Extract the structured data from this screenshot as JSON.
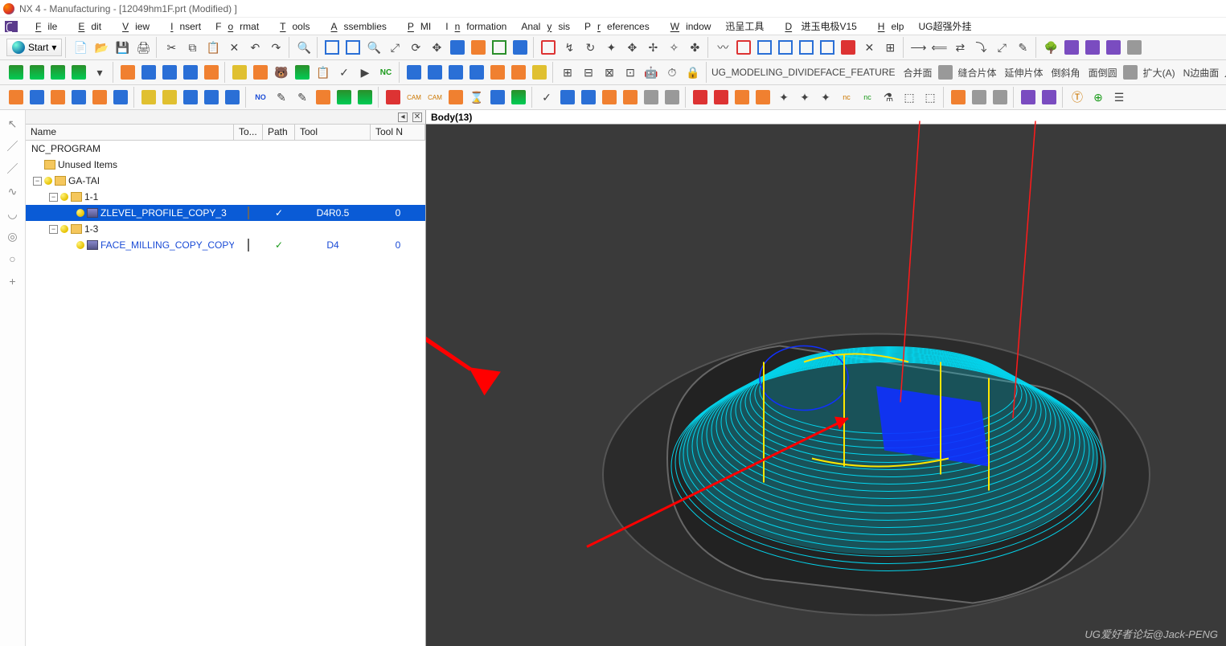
{
  "title": "NX 4 - Manufacturing - [12049hm1F.prt (Modified) ]",
  "menubar": {
    "items": [
      {
        "label": "File",
        "u": "F"
      },
      {
        "label": "Edit",
        "u": "E"
      },
      {
        "label": "View",
        "u": "V"
      },
      {
        "label": "Insert",
        "u": "I"
      },
      {
        "label": "Format",
        "u": "F"
      },
      {
        "label": "Tools",
        "u": "T"
      },
      {
        "label": "Assemblies",
        "u": "A"
      },
      {
        "label": "PMI",
        "u": "P"
      },
      {
        "label": "Information",
        "u": "I"
      },
      {
        "label": "Analysis",
        "u": "A"
      },
      {
        "label": "Preferences",
        "u": "P"
      },
      {
        "label": "Window",
        "u": "W"
      },
      {
        "label": "迅呈工具",
        "u": ""
      },
      {
        "label": "D 进玉电极V15",
        "u": "D"
      },
      {
        "label": "Help",
        "u": "H"
      },
      {
        "label": "UG超强外挂",
        "u": ""
      }
    ]
  },
  "start_label": "Start",
  "toolbar3_text": {
    "a": "UG_MODELING_DIVIDEFACE_FEATURE",
    "b": "合并面",
    "c": "缝合片体",
    "d": "延伸片体",
    "e": "倒斜角",
    "f": "面倒圆",
    "g": "扩大(A)",
    "h": "N边曲面"
  },
  "status": "Body(13)",
  "nav": {
    "columns": [
      "Name",
      "To...",
      "Path",
      "Tool",
      "Tool N"
    ],
    "root": "NC_PROGRAM",
    "unused": "Unused Items",
    "group": "GA-TAI",
    "p1": "1-1",
    "op1": {
      "name": "ZLEVEL_PROFILE_COPY_3",
      "tool": "D4R0.5",
      "tooln": "0"
    },
    "p3": "1-3",
    "op2": {
      "name": "FACE_MILLING_COPY_COPY",
      "tool": "D4",
      "tooln": "0"
    }
  },
  "watermark": "UG爱好者论坛@Jack-PENG"
}
